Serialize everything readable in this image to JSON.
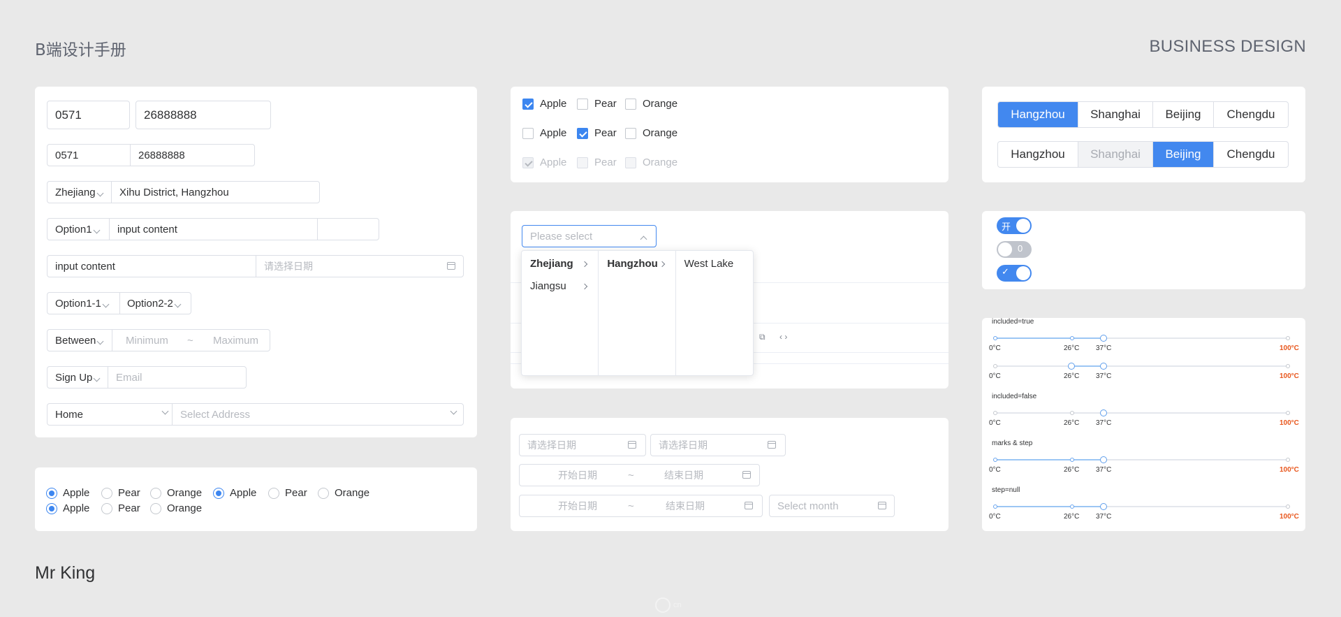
{
  "header": {
    "left": "B端设计手册",
    "right": "BUSINESS DESIGN"
  },
  "footer": {
    "author": "Mr King"
  },
  "inputs": {
    "row1": {
      "code": "0571",
      "phone": "26888888"
    },
    "row2": {
      "code": "0571",
      "phone": "26888888"
    },
    "row3": {
      "province": "Zhejiang",
      "address": "Xihu District, Hangzhou"
    },
    "row4": {
      "option": "Option1",
      "content": "input content"
    },
    "row5": {
      "content": "input content",
      "date_placeholder": "请选择日期"
    },
    "row6": {
      "option_a": "Option1-1",
      "option_b": "Option2-2"
    },
    "row7": {
      "mode": "Between",
      "min_placeholder": "Minimum",
      "tilde": "~",
      "max_placeholder": "Maximum"
    },
    "row8": {
      "mode": "Sign Up",
      "email_placeholder": "Email"
    },
    "row9": {
      "type": "Home",
      "address_placeholder": "Select Address"
    }
  },
  "radios": {
    "row1": [
      "Apple",
      "Pear",
      "Orange",
      "Apple",
      "Pear",
      "Orange"
    ],
    "row2": [
      "Apple",
      "Pear",
      "Orange"
    ]
  },
  "checkboxes": {
    "row1": [
      "Apple",
      "Pear",
      "Orange"
    ],
    "row2": [
      "Apple",
      "Pear",
      "Orange"
    ],
    "row3": [
      "Apple",
      "Pear",
      "Orange"
    ]
  },
  "cascader": {
    "placeholder": "Please select",
    "col1": [
      "Zhejiang",
      "Jiangsu"
    ],
    "col2": [
      "Hangzhou"
    ],
    "col3": [
      "West Lake"
    ]
  },
  "dates": {
    "single_placeholder": "请选择日期",
    "start_placeholder": "开始日期",
    "end_placeholder": "结束日期",
    "tilde": "~",
    "month_placeholder": "Select month"
  },
  "segments": {
    "row1": [
      "Hangzhou",
      "Shanghai",
      "Beijing",
      "Chengdu"
    ],
    "row2": [
      "Hangzhou",
      "Shanghai",
      "Beijing",
      "Chengdu"
    ]
  },
  "switches": {
    "on_text": "开",
    "off_text": "0",
    "check": "✓"
  },
  "sliders": {
    "label_included_true": "included=true",
    "label_included_false": "included=false",
    "label_marks_step": "marks & step",
    "label_step_null": "step=null",
    "marks": [
      "0°C",
      "26°C",
      "37°C",
      "100°C"
    ]
  },
  "colors": {
    "primary": "#4288ef",
    "danger_mark": "#e8561c",
    "background": "#e9e9e9"
  }
}
